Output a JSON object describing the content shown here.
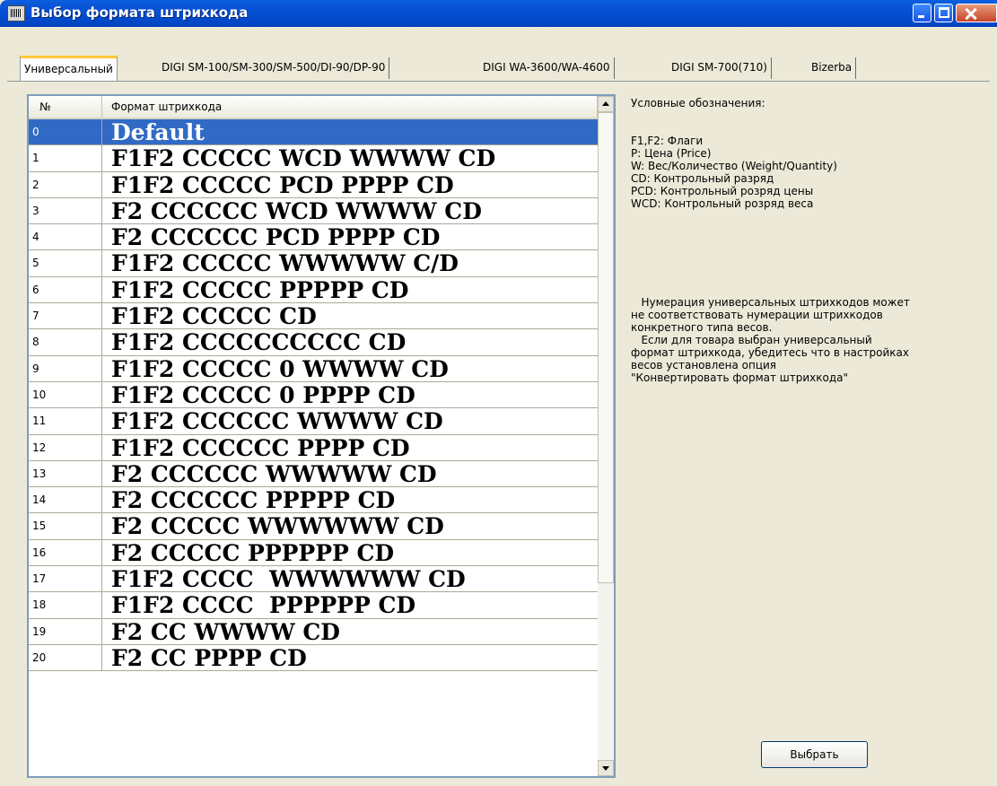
{
  "window": {
    "title": "Выбор формата штрихкода",
    "icon": "barcode-app-icon"
  },
  "tabs": [
    {
      "label": "Универсальный",
      "active": true
    },
    {
      "label": "DIGI SM-100/SM-300/SM-500/DI-90/DP-90",
      "active": false
    },
    {
      "label": "DIGI WA-3600/WA-4600",
      "active": false
    },
    {
      "label": "DIGI SM-700(710)",
      "active": false
    },
    {
      "label": "Bizerba",
      "active": false
    }
  ],
  "list": {
    "columns": {
      "num": "№",
      "format": "Формат штрихкода"
    },
    "rows": [
      {
        "num": "0",
        "format": "Default",
        "selected": true
      },
      {
        "num": "1",
        "format": "F1F2 CCCCC WCD WWWW CD"
      },
      {
        "num": "2",
        "format": "F1F2 CCCCC PCD PPPP CD"
      },
      {
        "num": "3",
        "format": "F2 CCCCCC WCD WWWW CD"
      },
      {
        "num": "4",
        "format": "F2 CCCCCC PCD PPPP CD"
      },
      {
        "num": "5",
        "format": "F1F2 CCCCC WWWWW C/D"
      },
      {
        "num": "6",
        "format": "F1F2 CCCCC PPPPP CD"
      },
      {
        "num": "7",
        "format": "F1F2 CCCCC CD"
      },
      {
        "num": "8",
        "format": "F1F2 CCCCCCCCCC CD"
      },
      {
        "num": "9",
        "format": "F1F2 CCCCC 0 WWWW CD"
      },
      {
        "num": "10",
        "format": "F1F2 CCCCC 0 PPPP CD"
      },
      {
        "num": "11",
        "format": "F1F2 CCCCCC WWWW CD"
      },
      {
        "num": "12",
        "format": "F1F2 CCCCCC PPPP CD"
      },
      {
        "num": "13",
        "format": "F2 CCCCCC WWWWW CD"
      },
      {
        "num": "14",
        "format": "F2 CCCCCC PPPPP CD"
      },
      {
        "num": "15",
        "format": "F2 CCCCC WWWWWW CD"
      },
      {
        "num": "16",
        "format": "F2 CCCCC PPPPPP CD"
      },
      {
        "num": "17",
        "format": "F1F2 CCCC  WWWWWW CD"
      },
      {
        "num": "18",
        "format": "F1F2 CCCC  PPPPPP CD"
      },
      {
        "num": "19",
        "format": "F2 CC WWWW CD"
      },
      {
        "num": "20",
        "format": "F2 CC PPPP CD"
      }
    ]
  },
  "legend": {
    "title": "Условные обозначения:",
    "items": [
      "F1,F2: Флаги",
      "P: Цена (Price)",
      "W: Вес/Количество (Weight/Quantity)",
      "CD: Контрольный разряд",
      "PCD: Контрольный розряд цены",
      "WCD: Контрольный розряд веса"
    ],
    "note_lines": [
      "   Нумерация универсальных штрихкодов может",
      "не соответствовать нумерации штрихкодов",
      "конкретного типа весов.",
      "   Если для товара выбран универсальный",
      "формат штрихкода, убедитесь что в настройках",
      "весов установлена опция",
      "\"Конвертировать формат штрихкода\""
    ]
  },
  "buttons": {
    "select": "Выбрать"
  },
  "colors": {
    "selection": "#316ac5",
    "titlebar": "#0047c6",
    "window_bg": "#ece9d8"
  }
}
